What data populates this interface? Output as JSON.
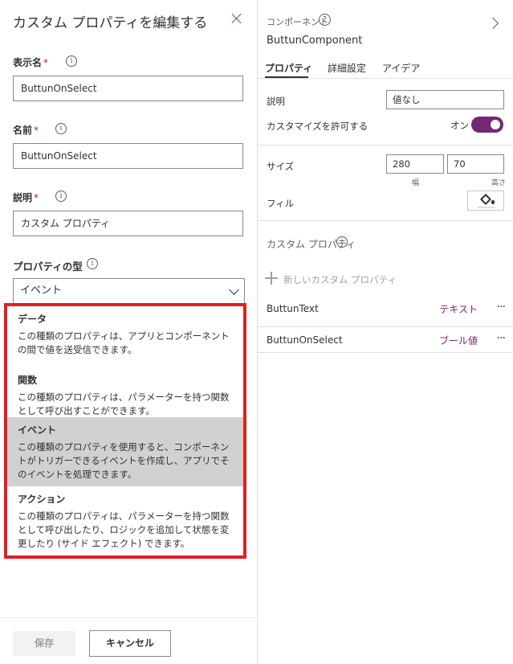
{
  "left_panel": {
    "title": "カスタム プロパティを編集する",
    "display_name": {
      "label": "表示名",
      "required_mark": "*",
      "value": "ButtunOnSelect"
    },
    "name": {
      "label": "名前",
      "required_mark": "*",
      "value": "ButtunOnSelect"
    },
    "description": {
      "label": "説明",
      "required_mark": "*",
      "value": "カスタム プロパティ"
    },
    "property_type": {
      "label": "プロパティの型",
      "selected": "イベント"
    },
    "options": [
      {
        "title": "データ",
        "desc": "この種類のプロパティは、アプリとコンポーネントの間で値を送受信できます。"
      },
      {
        "title": "関数",
        "desc": "この種類のプロパティは、パラメーターを持つ関数として呼び出すことができます。"
      },
      {
        "title": "イベント",
        "desc": "この種類のプロパティを使用すると、コンポーネントがトリガーできるイベントを作成し、アプリでそのイベントを処理できます。"
      },
      {
        "title": "アクション",
        "desc": "この種類のプロパティは、パラメーターを持つ関数として呼び出したり、ロジックを追加して状態を変更したり (サイド エフェクト) できます。"
      }
    ],
    "save_label": "保存",
    "cancel_label": "キャンセル"
  },
  "right_panel": {
    "section_label": "コンポーネント",
    "component_name": "ButtunComponent",
    "tabs": [
      "プロパティ",
      "詳細設定",
      "アイデア"
    ],
    "description_label": "説明",
    "description_value": "値なし",
    "customize_label": "カスタマイズを許可する",
    "toggle_state": "オン",
    "size_label": "サイズ",
    "width_value": "280",
    "height_value": "70",
    "width_sublabel": "幅",
    "height_sublabel": "高さ",
    "fill_label": "フィル",
    "custom_props_label": "カスタム プロパティ",
    "new_prop_label": "新しいカスタム プロパティ",
    "custom_props": [
      {
        "name": "ButtunText",
        "type": "テキスト"
      },
      {
        "name": "ButtunOnSelect",
        "type": "ブール値"
      }
    ]
  },
  "colors": {
    "accent": "#742774",
    "highlight_border": "#e01e26",
    "selected_option": "#d1d1d1"
  }
}
